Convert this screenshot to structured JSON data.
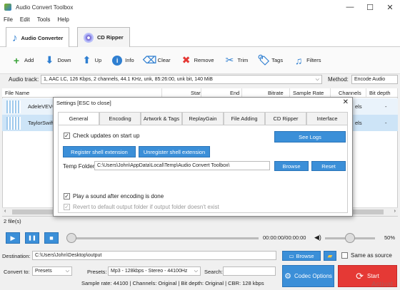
{
  "window": {
    "title": "Audio Convert Toolbox",
    "minimize": "—",
    "maximize": "☐",
    "close": "✕"
  },
  "menu": [
    "File",
    "Edit",
    "Tools",
    "Help"
  ],
  "main_tabs": {
    "converter": "Audio Converter",
    "ripper": "CD Ripper"
  },
  "toolbar": {
    "add": "Add",
    "down": "Down",
    "up": "Up",
    "info": "Info",
    "clear": "Clear",
    "remove": "Remove",
    "trim": "Trim",
    "tags": "Tags",
    "filters": "Filters"
  },
  "audio_track": {
    "label": "Audio track:",
    "value": "1, AAC LC, 126 Kbps, 2 channels, 44.1 KHz, unk, 85:26:00, unk bit, 140 MiB"
  },
  "method": {
    "label": "Method:",
    "value": "Encode Audio"
  },
  "columns": [
    "File Name",
    "Start",
    "End",
    "Bitrate",
    "Sample Rate",
    "Channels",
    "Bit depth"
  ],
  "files": [
    {
      "name": "AdeleVEVO",
      "channels": "els",
      "bitdepth": "-"
    },
    {
      "name": "TaylorSwift",
      "channels": "els",
      "bitdepth": "-"
    }
  ],
  "dialog": {
    "title": "Settings [ESC to close]",
    "close": "✕",
    "tabs": [
      "General",
      "Encoding",
      "Artwork & Tags",
      "ReplayGain",
      "File Adding",
      "CD Ripper",
      "Interface"
    ],
    "check_updates": "Check updates on start up",
    "see_logs": "See Logs",
    "register_shell": "Register shell extension",
    "unregister_shell": "Unregister shell extension",
    "temp_label": "Temp Folder:",
    "temp_value": "C:\\Users\\John\\AppData\\Local\\Temp\\Audio Convert Toolbox\\",
    "browse": "Browse",
    "reset": "Reset",
    "play_sound": "Play a sound after encoding is done",
    "revert_output": "Revert to default output folder if output folder doesn't exist"
  },
  "file_count": "2 file(s)",
  "player": {
    "time": "00:00:00/00:00:00",
    "volume": "50%",
    "play": "▶",
    "pause": "❚❚",
    "stop": "■",
    "seek_fraction": 0.0,
    "volume_fraction": 0.5
  },
  "destination": {
    "label": "Destination:",
    "value": "C:\\Users\\John\\Desktop\\output",
    "browse": "Browse",
    "same_as_source": "Same as source"
  },
  "convert_to": {
    "label": "Convert to:",
    "value": "Presets"
  },
  "presets": {
    "label": "Presets:",
    "value": "Mp3 - 128kbps - Stereo - 44100Hz"
  },
  "search": {
    "label": "Search:",
    "value": ""
  },
  "codec_options": "Codec Options",
  "start": "Start",
  "summary": "Sample rate: 44100 | Channels: Original | Bit depth: Original | CBR: 128 kbps",
  "watermark": "Activat",
  "colors": {
    "accent": "#3b8fd8",
    "start": "#e53935",
    "selected_row": "#cde4f7"
  }
}
